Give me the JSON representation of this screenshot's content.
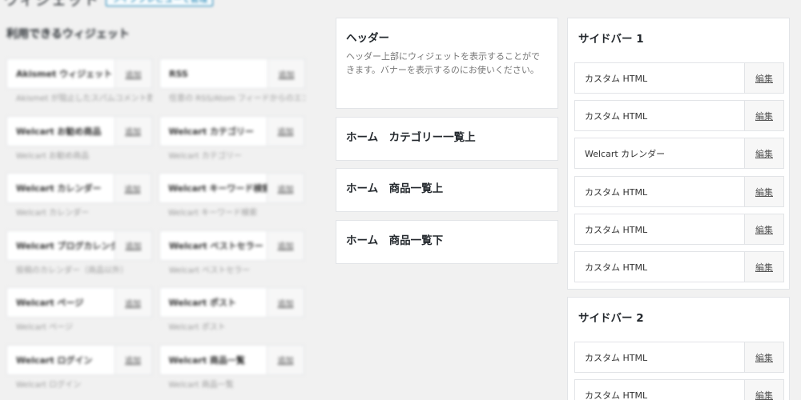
{
  "page": {
    "title": "ウィジェット",
    "manage_button": "ライブプレビューで管理"
  },
  "available": {
    "title": "利用できるウィジェット",
    "rows": [
      [
        {
          "name": "Akismet ウィジェット",
          "add": "追加",
          "desc": "Akismet が阻止したスパムコメント数を表示"
        },
        {
          "name": "RSS",
          "add": "追加",
          "desc": "任意の RSS/Atom フィードからのエントリー。"
        }
      ],
      [
        {
          "name": "Welcart お勧め商品",
          "add": "追加",
          "desc": "Welcart お勧め商品"
        },
        {
          "name": "Welcart カテゴリー",
          "add": "追加",
          "desc": "Welcart カテゴリー"
        }
      ],
      [
        {
          "name": "Welcart カレンダー",
          "add": "追加",
          "desc": "Welcart カレンダー"
        },
        {
          "name": "Welcart キーワード検索",
          "add": "追加",
          "desc": "Welcart キーワード検索"
        }
      ],
      [
        {
          "name": "Welcart ブログカレンダー",
          "add": "追加",
          "desc": "投稿のカレンダー（商品以外）"
        },
        {
          "name": "Welcart ベストセラー",
          "add": "追加",
          "desc": "Welcart ベストセラー"
        }
      ],
      [
        {
          "name": "Welcart ページ",
          "add": "追加",
          "desc": "Welcart ページ"
        },
        {
          "name": "Welcart ポスト",
          "add": "追加",
          "desc": "Welcart ポスト"
        }
      ],
      [
        {
          "name": "Welcart ログイン",
          "add": "追加",
          "desc": "Welcart ログイン"
        },
        {
          "name": "Welcart 商品一覧",
          "add": "追加",
          "desc": "Welcart 商品一覧"
        }
      ]
    ]
  },
  "areas": {
    "header": {
      "title": "ヘッダー",
      "desc": "ヘッダー上部にウィジェットを表示することができます。バナーを表示するのにお使いください。"
    },
    "home_category_top": {
      "title": "ホーム　カテゴリー一覧上"
    },
    "home_items_top": {
      "title": "ホーム　商品一覧上"
    },
    "home_items_bottom": {
      "title": "ホーム　商品一覧下"
    }
  },
  "sidebar1": {
    "title": "サイドバー 1",
    "widgets": [
      {
        "name": "カスタム HTML",
        "edit": "編集"
      },
      {
        "name": "カスタム HTML",
        "edit": "編集"
      },
      {
        "name": "Welcart カレンダー",
        "edit": "編集"
      },
      {
        "name": "カスタム HTML",
        "edit": "編集"
      },
      {
        "name": "カスタム HTML",
        "edit": "編集"
      },
      {
        "name": "カスタム HTML",
        "edit": "編集"
      }
    ]
  },
  "sidebar2": {
    "title": "サイドバー 2",
    "widgets": [
      {
        "name": "カスタム HTML",
        "edit": "編集"
      },
      {
        "name": "カスタム HTML",
        "edit": "編集"
      }
    ]
  }
}
